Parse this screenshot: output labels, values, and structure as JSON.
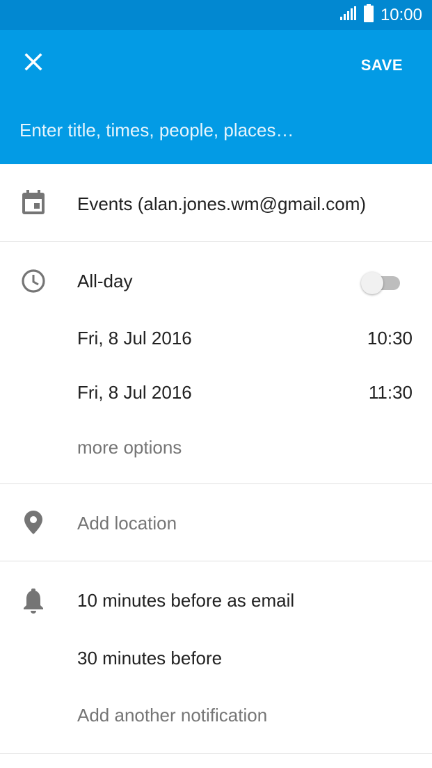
{
  "status_bar": {
    "time": "10:00",
    "icons": [
      "signal-icon",
      "battery-icon"
    ]
  },
  "app_bar": {
    "close_icon": "close-icon",
    "save_label": "SAVE",
    "title_placeholder": "Enter title, times, people, places…",
    "title_value": ""
  },
  "calendar": {
    "icon": "calendar-icon",
    "account": "Events (alan.jones.wm@gmail.com)"
  },
  "time": {
    "icon": "clock-icon",
    "all_day_label": "All-day",
    "all_day_enabled": false,
    "start_date": "Fri, 8 Jul 2016",
    "start_time": "10:30",
    "end_date": "Fri, 8 Jul 2016",
    "end_time": "11:30",
    "more_options": "more options"
  },
  "location": {
    "icon": "location-pin-icon",
    "placeholder": "Add location"
  },
  "notifications": {
    "icon": "bell-icon",
    "items": [
      "10 minutes before as email",
      "30 minutes before"
    ],
    "add_label": "Add another notification"
  },
  "colors": {
    "status_bar": "#0288d1",
    "app_bar": "#039be5",
    "text_primary": "#212121",
    "text_secondary": "#757575",
    "icon_grey": "#757575"
  }
}
